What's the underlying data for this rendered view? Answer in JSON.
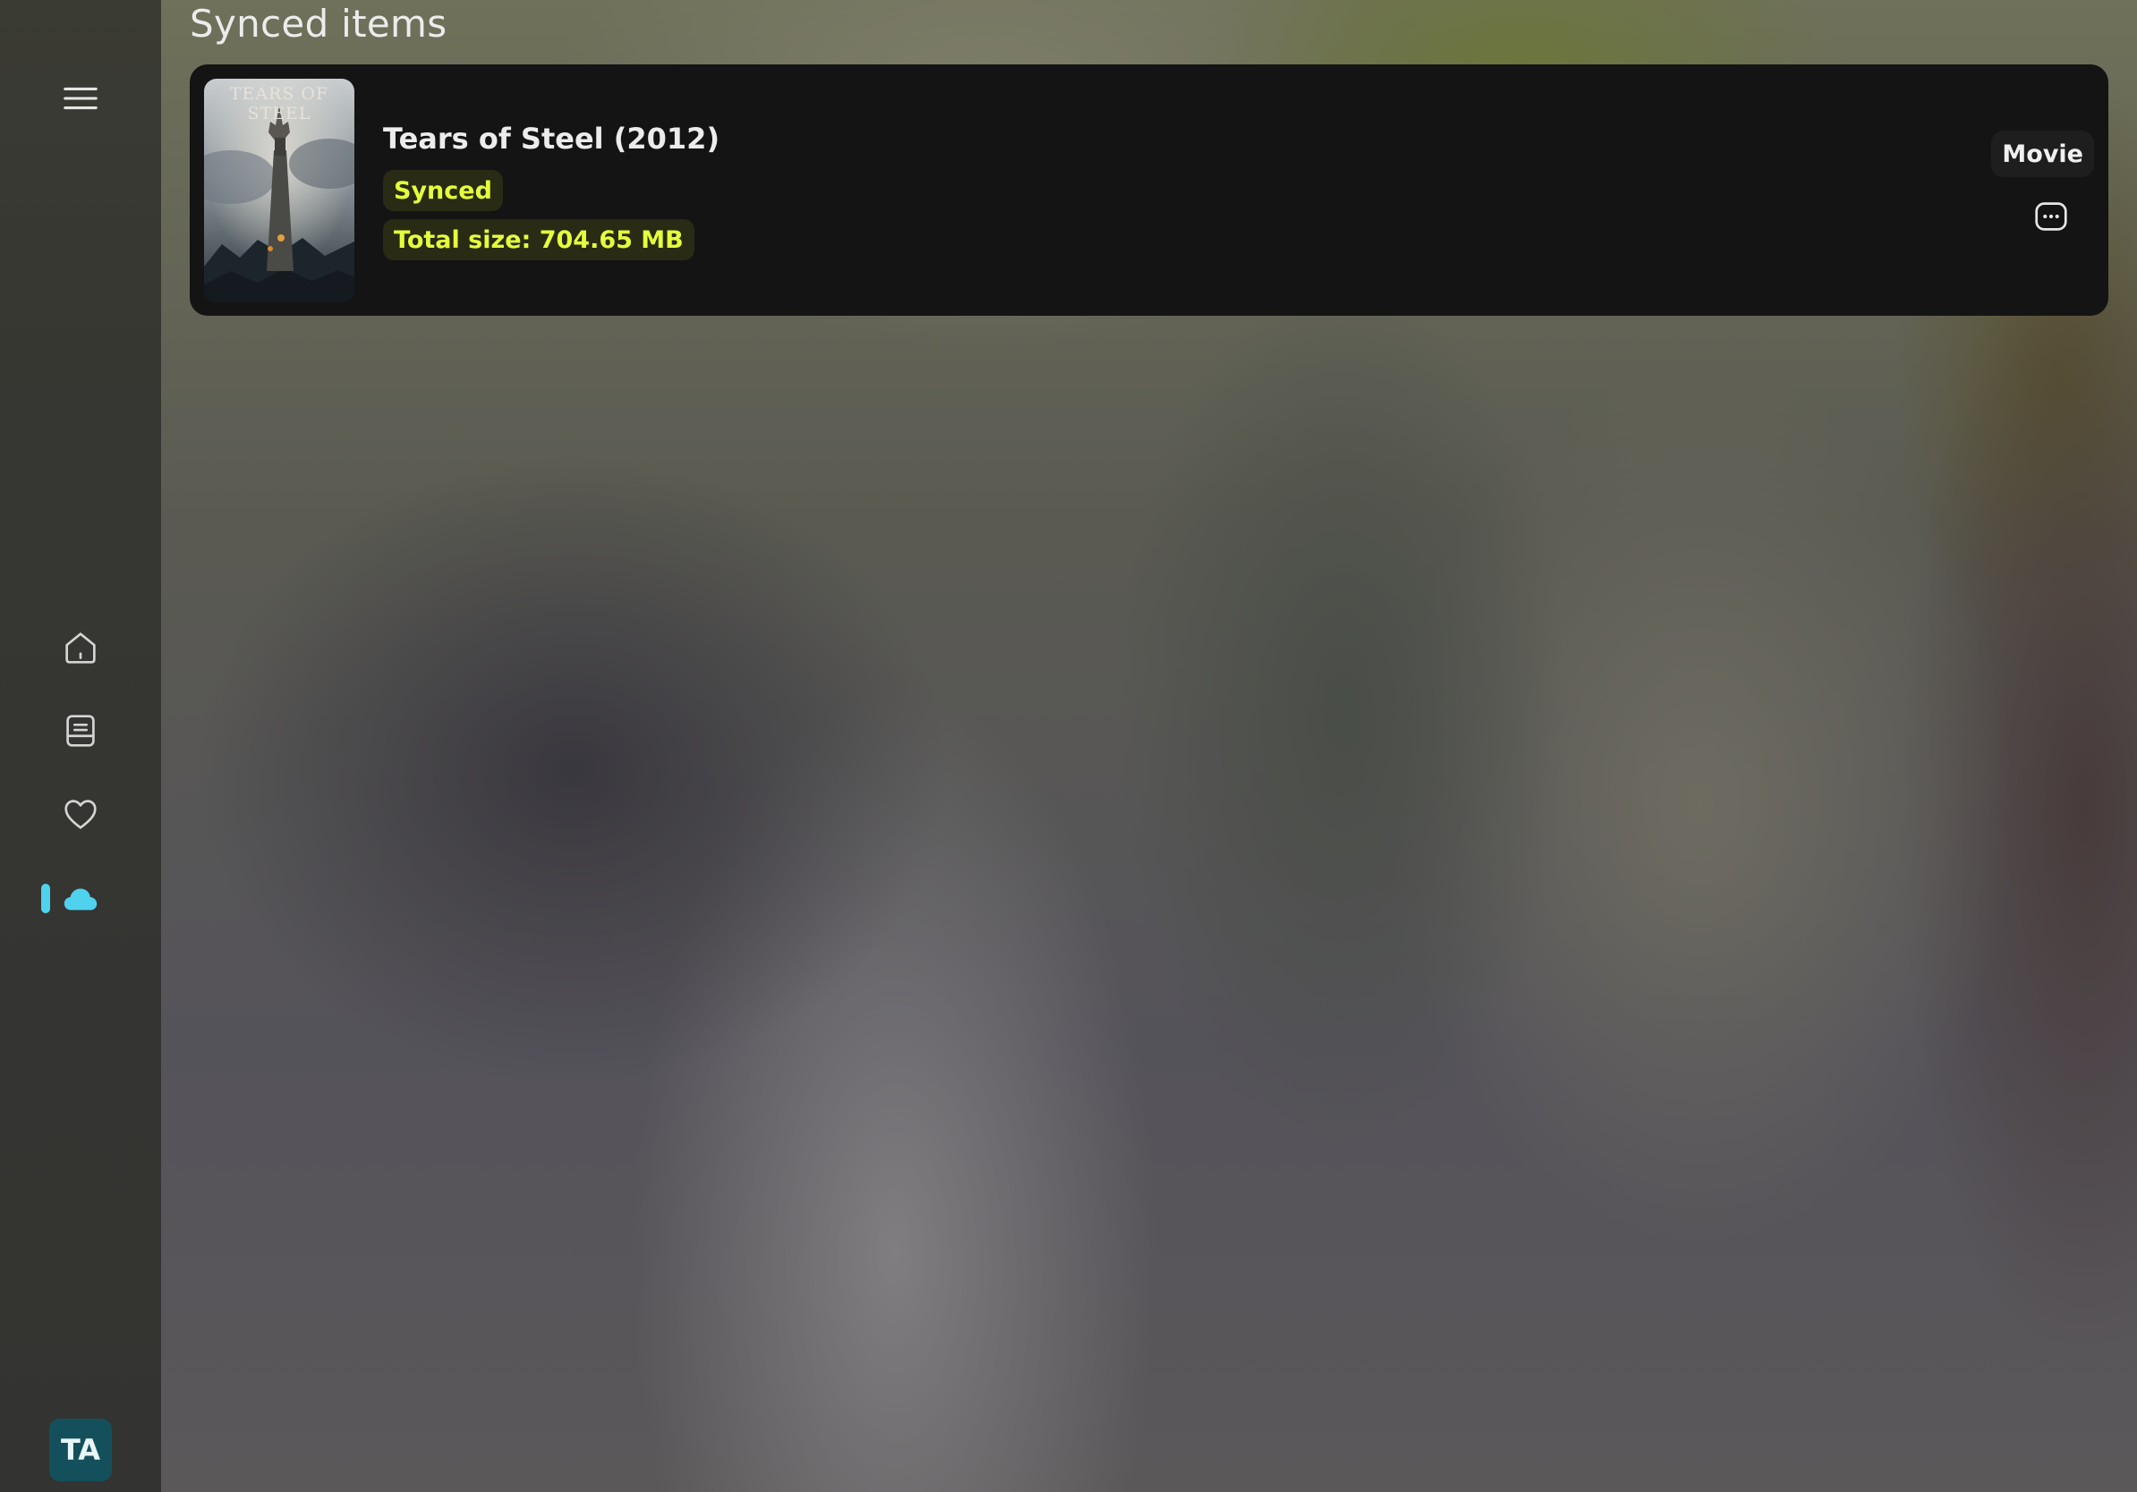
{
  "sidebar": {
    "items": [
      {
        "name": "menu",
        "icon": "hamburger-menu-icon"
      },
      {
        "name": "home",
        "icon": "home-icon"
      },
      {
        "name": "library",
        "icon": "library-icon"
      },
      {
        "name": "favorites",
        "icon": "heart-icon"
      },
      {
        "name": "synced",
        "icon": "cloud-icon",
        "active": true
      }
    ],
    "avatar_initials": "TA",
    "accent_color": "#4fd2ee"
  },
  "main": {
    "title": "Synced items",
    "items": [
      {
        "poster_text": "TEARS OF STEEL",
        "title": "Tears of Steel (2012)",
        "status": "Synced",
        "size": "Total size: 704.65 MB",
        "type": "Movie",
        "more_icon": "more-options-icon"
      }
    ]
  },
  "colors": {
    "badge_text": "#e4ff3c",
    "card_bg": "#141414",
    "avatar_bg": "#14505c"
  }
}
